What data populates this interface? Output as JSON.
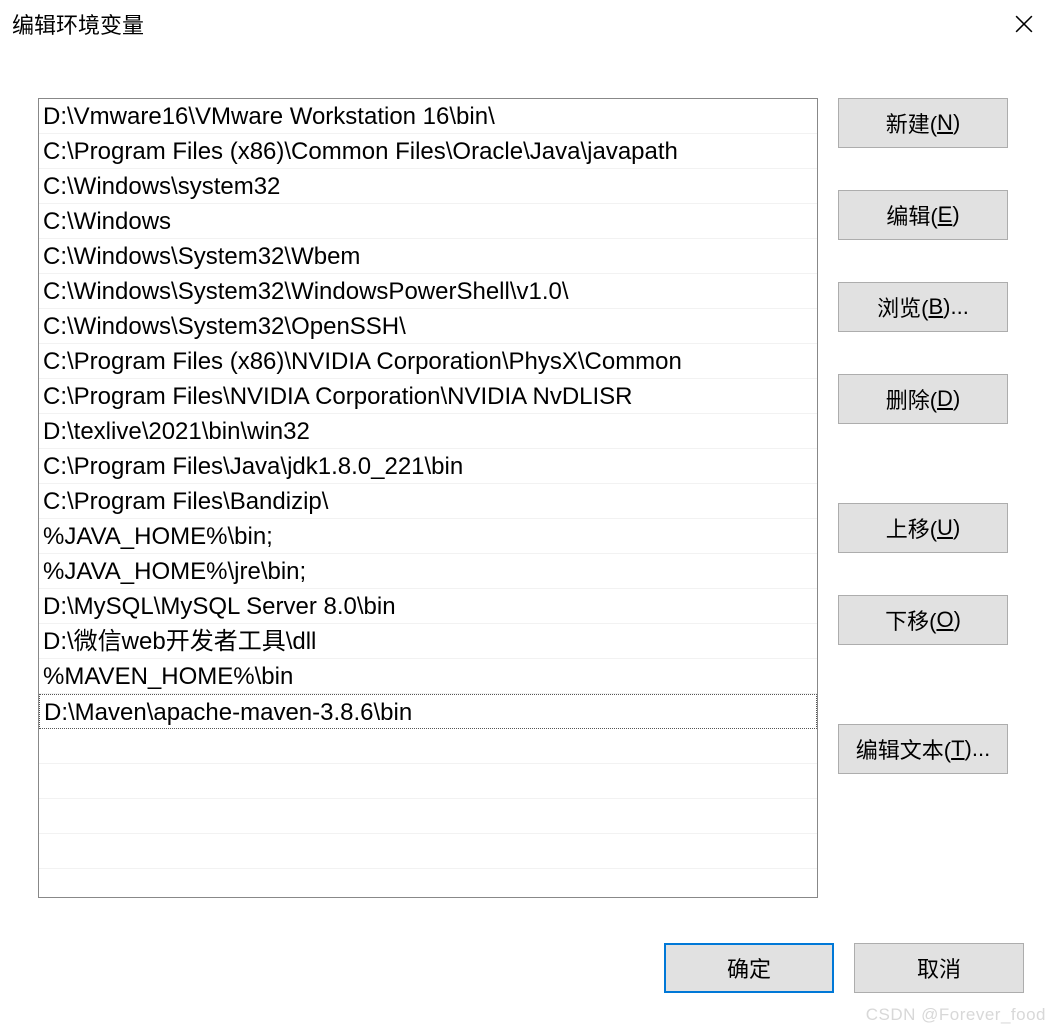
{
  "titlebar": {
    "title": "编辑环境变量"
  },
  "list": {
    "items": [
      "D:\\Vmware16\\VMware Workstation 16\\bin\\",
      "C:\\Program Files (x86)\\Common Files\\Oracle\\Java\\javapath",
      "C:\\Windows\\system32",
      "C:\\Windows",
      "C:\\Windows\\System32\\Wbem",
      "C:\\Windows\\System32\\WindowsPowerShell\\v1.0\\",
      "C:\\Windows\\System32\\OpenSSH\\",
      "C:\\Program Files (x86)\\NVIDIA Corporation\\PhysX\\Common",
      "C:\\Program Files\\NVIDIA Corporation\\NVIDIA NvDLISR",
      "D:\\texlive\\2021\\bin\\win32",
      "C:\\Program Files\\Java\\jdk1.8.0_221\\bin",
      "C:\\Program Files\\Bandizip\\",
      "%JAVA_HOME%\\bin;",
      "%JAVA_HOME%\\jre\\bin;",
      "D:\\MySQL\\MySQL Server 8.0\\bin",
      "D:\\微信web开发者工具\\dll",
      "%MAVEN_HOME%\\bin",
      "D:\\Maven\\apache-maven-3.8.6\\bin"
    ],
    "selected_index": 17
  },
  "buttons": {
    "new": {
      "prefix": "新建(",
      "key": "N",
      "suffix": ")"
    },
    "edit": {
      "prefix": "编辑(",
      "key": "E",
      "suffix": ")"
    },
    "browse": {
      "prefix": "浏览(",
      "key": "B",
      "suffix": ")..."
    },
    "delete": {
      "prefix": "删除(",
      "key": "D",
      "suffix": ")"
    },
    "moveup": {
      "prefix": "上移(",
      "key": "U",
      "suffix": ")"
    },
    "movedown": {
      "prefix": "下移(",
      "key": "O",
      "suffix": ")"
    },
    "edittext": {
      "prefix": "编辑文本(",
      "key": "T",
      "suffix": ")..."
    }
  },
  "footer": {
    "ok": "确定",
    "cancel": "取消"
  },
  "watermark": "CSDN @Forever_food"
}
